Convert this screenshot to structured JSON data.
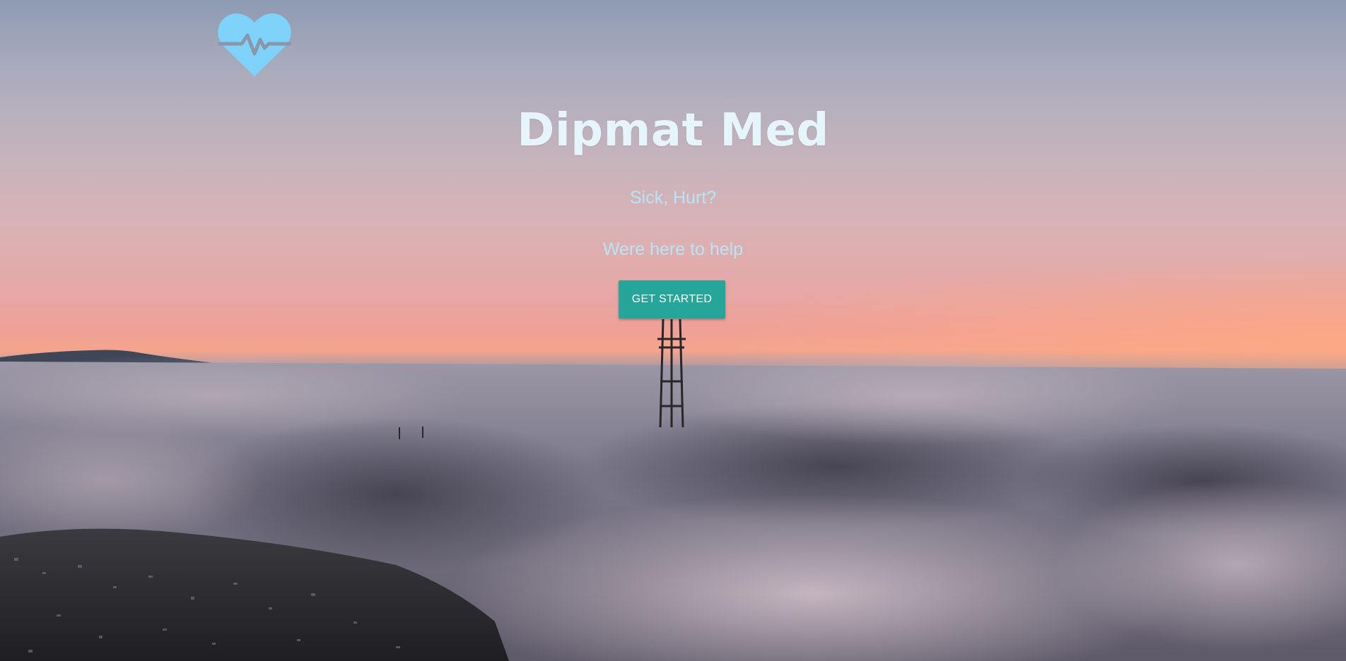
{
  "hero": {
    "title": "Dipmat Med",
    "tagline_1": "Sick, Hurt?",
    "tagline_2": "Were here to help",
    "cta_label": "GET STARTED",
    "logo_icon": "heart-pulse-icon"
  },
  "colors": {
    "logo": "#7fd3fa",
    "title": "#e6f5fc",
    "tagline": "#b8e4f7",
    "cta_background": "#26a69a",
    "cta_text": "#ffffff"
  }
}
